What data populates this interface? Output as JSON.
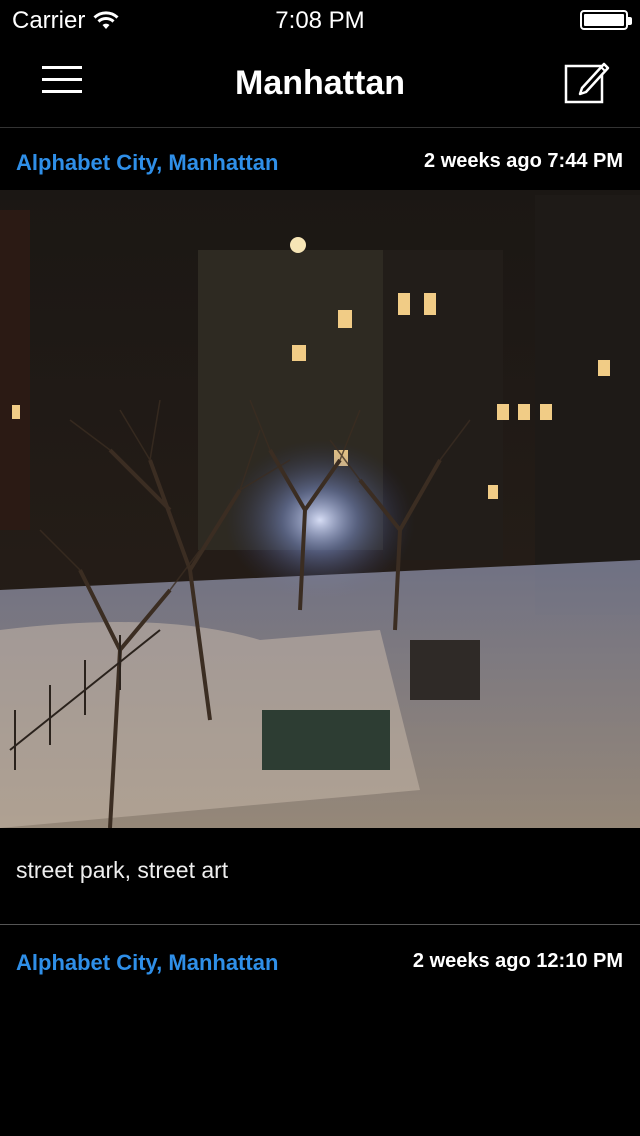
{
  "status_bar": {
    "carrier": "Carrier",
    "time": "7:08 PM"
  },
  "nav": {
    "title": "Manhattan",
    "menu_icon": "hamburger-menu-icon",
    "compose_icon": "compose-icon"
  },
  "posts": [
    {
      "location": "Alphabet City, Manhattan",
      "timestamp": "2 weeks ago 7:44 PM",
      "caption": "street park, street art"
    },
    {
      "location": "Alphabet City, Manhattan",
      "timestamp": "2 weeks ago 12:10 PM"
    }
  ],
  "colors": {
    "background": "#000000",
    "link": "#2f8fe8",
    "text": "#ffffff"
  }
}
